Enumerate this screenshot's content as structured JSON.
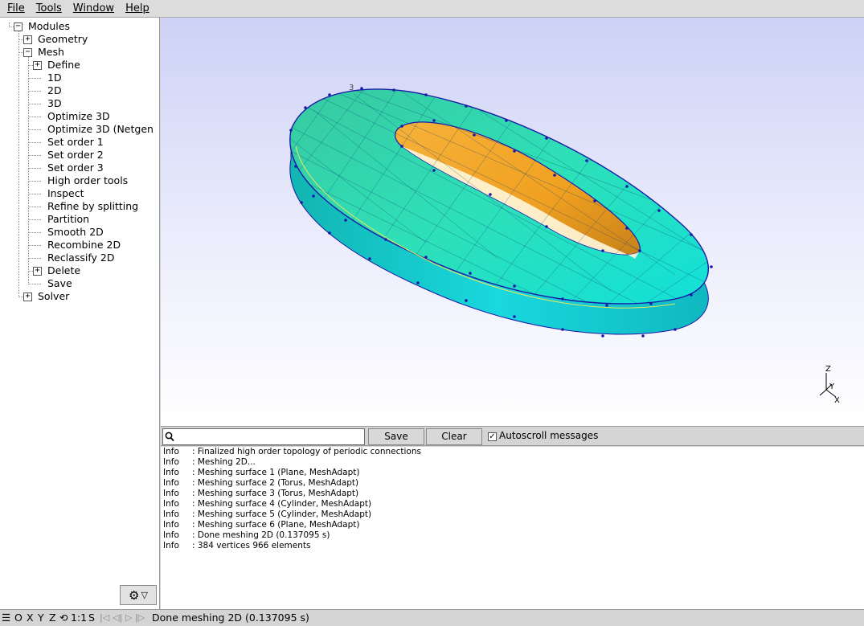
{
  "menu": [
    "File",
    "Tools",
    "Window",
    "Help"
  ],
  "tree": {
    "root": "Modules",
    "items": [
      {
        "label": "Geometry",
        "box": "+"
      },
      {
        "label": "Mesh",
        "box": "−"
      },
      {
        "label": "Define",
        "box": "+"
      },
      {
        "label": "1D"
      },
      {
        "label": "2D"
      },
      {
        "label": "3D"
      },
      {
        "label": "Optimize 3D"
      },
      {
        "label": "Optimize 3D (Netgen"
      },
      {
        "label": "Set order 1"
      },
      {
        "label": "Set order 2"
      },
      {
        "label": "Set order 3"
      },
      {
        "label": "High order tools"
      },
      {
        "label": "Inspect"
      },
      {
        "label": "Refine by splitting"
      },
      {
        "label": "Partition"
      },
      {
        "label": "Smooth 2D"
      },
      {
        "label": "Recombine 2D"
      },
      {
        "label": "Reclassify 2D"
      },
      {
        "label": "Delete",
        "box": "+"
      },
      {
        "label": "Save"
      },
      {
        "label": "Solver",
        "box": "+"
      }
    ]
  },
  "gear_button": {
    "icon": "gear-icon",
    "caret": "▽"
  },
  "viewport": {
    "axes": {
      "z": "Z",
      "y": "Y",
      "x": "X"
    },
    "model_tag": "3",
    "colors": {
      "outer_top": "#33d6a6",
      "side": "#17d3dc",
      "inner": "#f5a623",
      "edges": "#1a1aa8"
    }
  },
  "messages_toolbar": {
    "search_value": "",
    "save_label": "Save",
    "clear_label": "Clear",
    "autoscroll_checked": "✓",
    "autoscroll_label": "Autoscroll messages"
  },
  "log": [
    {
      "level": "Info",
      "text": ": Finalized high order topology of periodic connections"
    },
    {
      "level": "Info",
      "text": ": Meshing 2D..."
    },
    {
      "level": "Info",
      "text": ": Meshing surface 1 (Plane, MeshAdapt)"
    },
    {
      "level": "Info",
      "text": ": Meshing surface 2 (Torus, MeshAdapt)"
    },
    {
      "level": "Info",
      "text": ": Meshing surface 3 (Torus, MeshAdapt)"
    },
    {
      "level": "Info",
      "text": ": Meshing surface 4 (Cylinder, MeshAdapt)"
    },
    {
      "level": "Info",
      "text": ": Meshing surface 5 (Cylinder, MeshAdapt)"
    },
    {
      "level": "Info",
      "text": ": Meshing surface 6 (Plane, MeshAdapt)"
    },
    {
      "level": "Info",
      "text": ": Done meshing 2D (0.137095 s)"
    },
    {
      "level": "Info",
      "text": ": 384 vertices 966 elements"
    }
  ],
  "statusbar": {
    "menu_icon": "☰",
    "views": [
      "O",
      "X",
      "Y",
      "Z"
    ],
    "rotate_icon": "rotate-icon",
    "scale": "1:1",
    "s_label": "S",
    "status_text": "Done meshing 2D (0.137095 s)"
  }
}
